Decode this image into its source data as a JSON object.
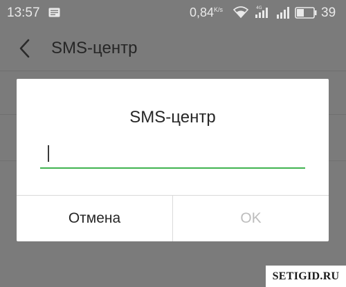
{
  "status_bar": {
    "time": "13:57",
    "speed_value": "0,84",
    "speed_unit": "K/s",
    "battery": "39",
    "icons": [
      "message-icon",
      "wifi-icon",
      "signal-icon",
      "signal-icon",
      "battery-icon"
    ]
  },
  "toolbar": {
    "back_icon": "chevron-left-icon",
    "title": "SMS-центр"
  },
  "dialog": {
    "title": "SMS-центр",
    "input_value": "",
    "accent_color": "#3fb34f",
    "cancel_label": "Отмена",
    "ok_label": "OK",
    "ok_enabled": false
  },
  "watermark": "SETIGID.RU"
}
